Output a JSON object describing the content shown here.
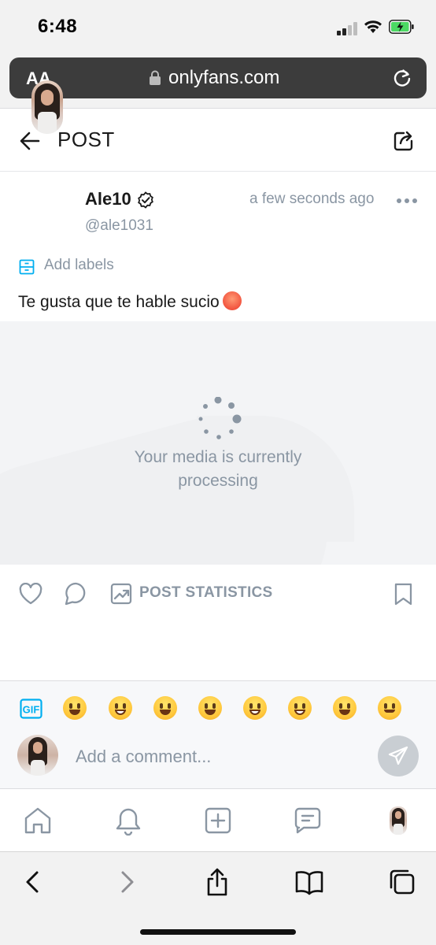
{
  "status_bar": {
    "time": "6:48"
  },
  "browser": {
    "text_size_label": "AA",
    "url": "onlyfans.com"
  },
  "header": {
    "title": "POST"
  },
  "post": {
    "author_name": "Ale10",
    "author_handle": "@ale1031",
    "timestamp": "a few seconds ago",
    "add_labels": "Add labels",
    "text": "Te gusta que te hable sucio",
    "text_emoji": "hot-face-emoji",
    "media_status": "Your media is currently\nprocessing",
    "statistics_label": "POST STATISTICS"
  },
  "comment_bar": {
    "gif_label": "GIF",
    "emojis": [
      "grinning-face",
      "beaming-face",
      "tears-of-joy-face",
      "grinning-big-eyes-face",
      "grinning-smiling-eyes-face",
      "sweat-smile-face",
      "squinting-laugh-face",
      "winking-face"
    ],
    "placeholder": "Add a comment..."
  },
  "bottom_nav": {
    "items": [
      "home-icon",
      "notifications-bell-icon",
      "add-post-icon",
      "messages-icon",
      "profile-avatar"
    ]
  },
  "safari_toolbar": {
    "items": [
      "back-chevron-icon",
      "forward-chevron-icon",
      "share-icon",
      "bookmarks-book-icon",
      "tabs-icon"
    ]
  },
  "colors": {
    "accent": "#00aff0",
    "muted": "#8a96a3",
    "text": "#1a1a1a"
  }
}
